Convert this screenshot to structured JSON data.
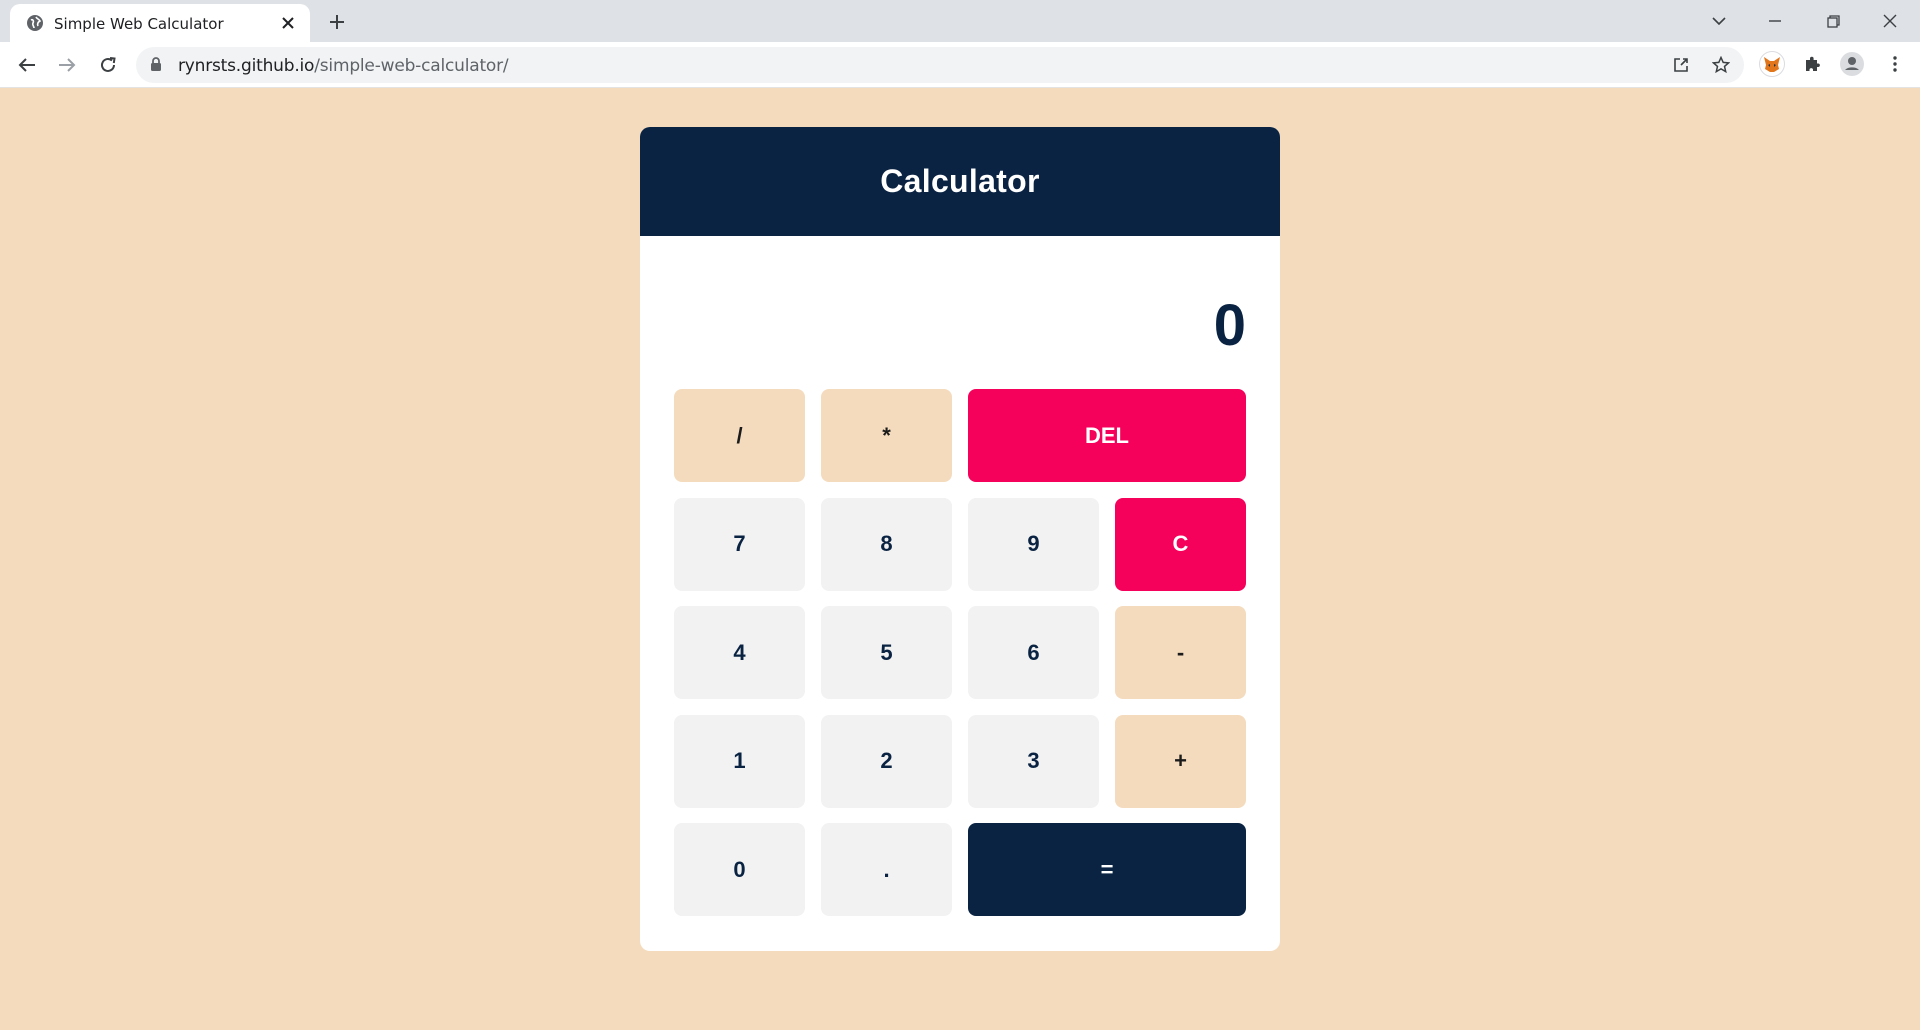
{
  "browser": {
    "tab_title": "Simple Web Calculator",
    "url_host": "rynrsts.github.io",
    "url_path": "/simple-web-calculator/"
  },
  "calculator": {
    "title": "Calculator",
    "display": "0",
    "keys": {
      "divide": "/",
      "multiply": "*",
      "delete": "DEL",
      "seven": "7",
      "eight": "8",
      "nine": "9",
      "clear": "C",
      "four": "4",
      "five": "5",
      "six": "6",
      "minus": "-",
      "one": "1",
      "two": "2",
      "three": "3",
      "plus": "+",
      "zero": "0",
      "decimal": ".",
      "equals": "="
    }
  },
  "colors": {
    "page_background": "#f4dbbd",
    "header": "#0a2342",
    "danger": "#f5005a",
    "number_key": "#f2f2f2",
    "operator_key": "#f4dbbd"
  }
}
